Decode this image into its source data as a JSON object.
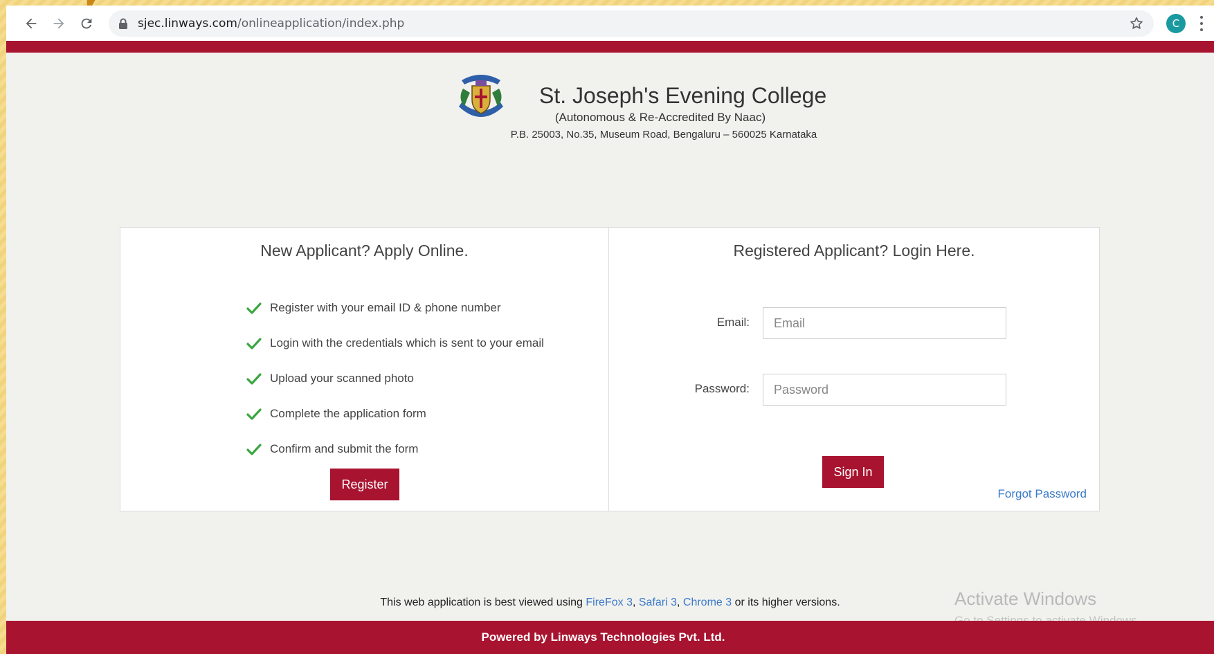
{
  "browser": {
    "url_host": "sjec.linways.com",
    "url_path": "/onlineapplication/index.php",
    "avatar_letter": "C",
    "icons": [
      "back-arrow-icon",
      "forward-arrow-icon",
      "reload-icon",
      "lock-icon",
      "star-icon",
      "kebab-menu-icon"
    ]
  },
  "college": {
    "name": "St. Joseph's Evening College",
    "subtitle": "(Autonomous & Re-Accredited By Naac)",
    "address": "P.B. 25003, No.35, Museum Road, Bengaluru – 560025 Karnataka"
  },
  "apply": {
    "title": "New Applicant? Apply Online.",
    "steps": [
      "Register with your email ID & phone number",
      "Login with the credentials which is sent to your email",
      "Upload your scanned photo",
      "Complete the application form",
      "Confirm and submit the form"
    ],
    "register_label": "Register"
  },
  "login": {
    "title": "Registered Applicant? Login Here.",
    "email_label": "Email:",
    "email_placeholder": "Email",
    "password_label": "Password:",
    "password_placeholder": "Password",
    "signin_label": "Sign In",
    "forgot_label": "Forgot Password"
  },
  "note": {
    "prefix": "This web application is best viewed using ",
    "firefox": "FireFox 3",
    "sep1": ", ",
    "safari": "Safari 3",
    "sep2": ", ",
    "chrome": "Chrome 3",
    "suffix": " or its higher versions."
  },
  "watermark": {
    "line1": "Activate Windows",
    "line2": "Go to Settings to activate Windows."
  },
  "footer": {
    "text": "Powered by Linways Technologies Pvt. Ltd."
  },
  "colors": {
    "brand": "#a8132f",
    "link": "#3b7ac8",
    "check": "#3aa640"
  }
}
